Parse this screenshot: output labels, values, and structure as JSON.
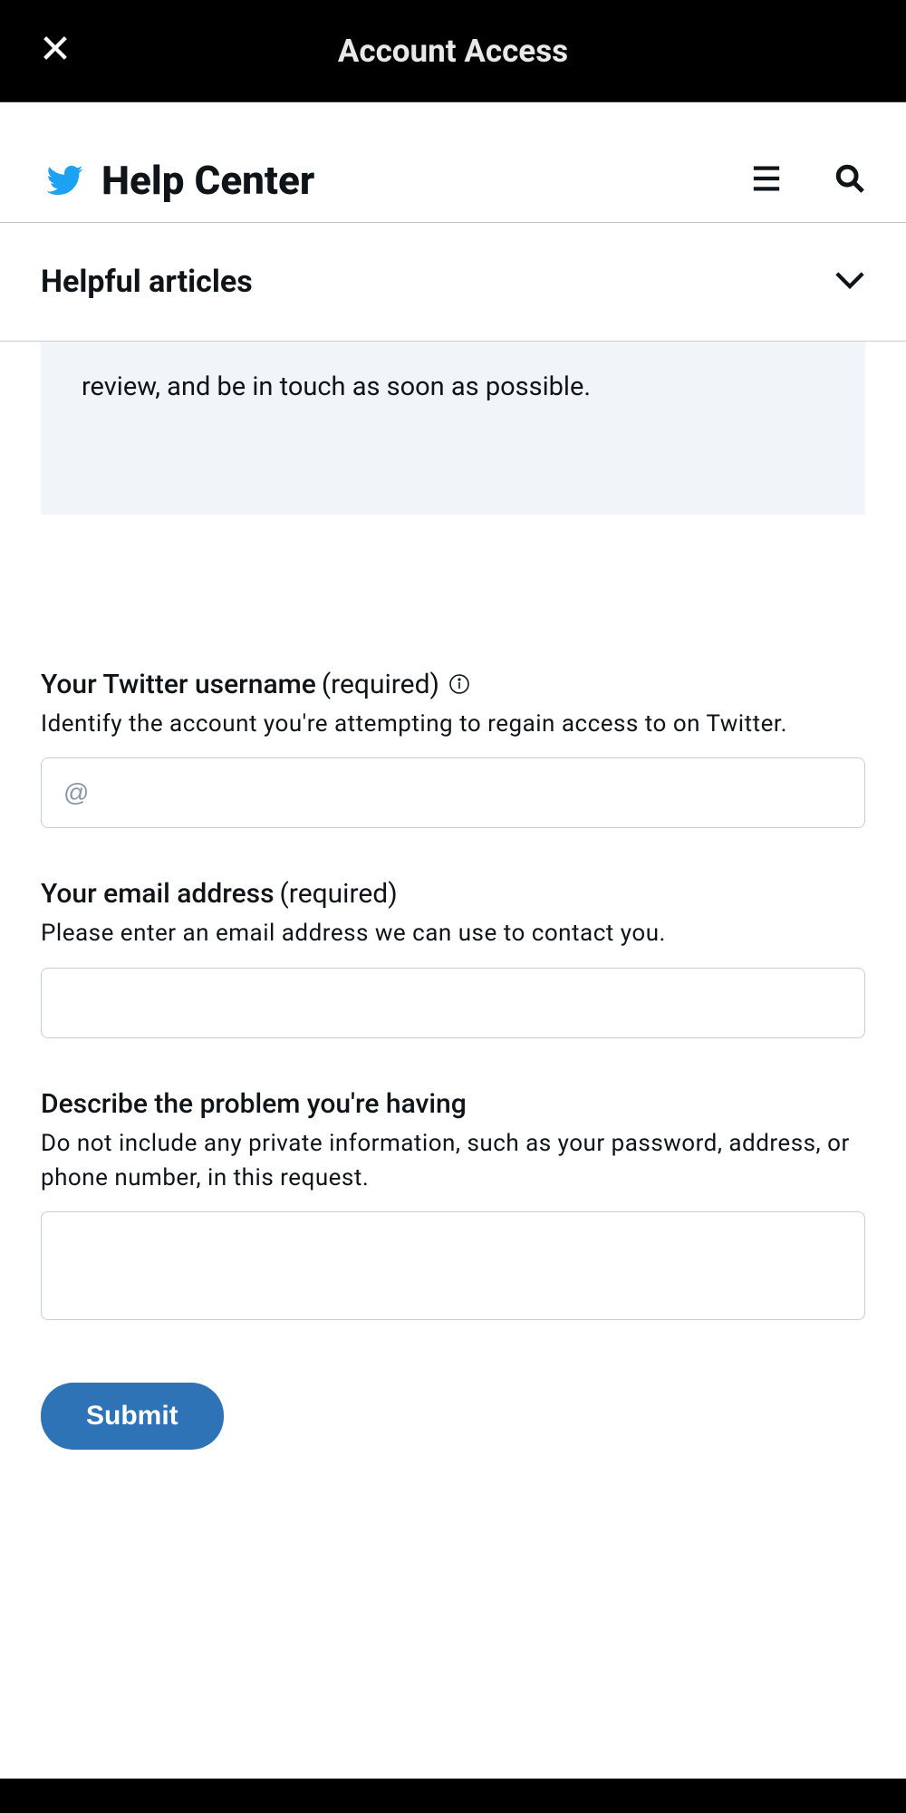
{
  "topbar": {
    "title": "Account Access"
  },
  "header": {
    "brand": "Help Center"
  },
  "articles": {
    "title": "Helpful articles"
  },
  "infoCard": {
    "text": "review, and be in touch as soon as possible."
  },
  "form": {
    "username": {
      "label": "Your Twitter username",
      "required": "(required)",
      "help": "Identify the account you're attempting to regain access to on Twitter.",
      "placeholder": "@"
    },
    "email": {
      "label": "Your email address",
      "required": "(required)",
      "help": "Please enter an email address we can use to contact you."
    },
    "problem": {
      "label": "Describe the problem you're having",
      "help": "Do not include any private information, such as your password, address, or phone number, in this request."
    },
    "submit": "Submit"
  }
}
